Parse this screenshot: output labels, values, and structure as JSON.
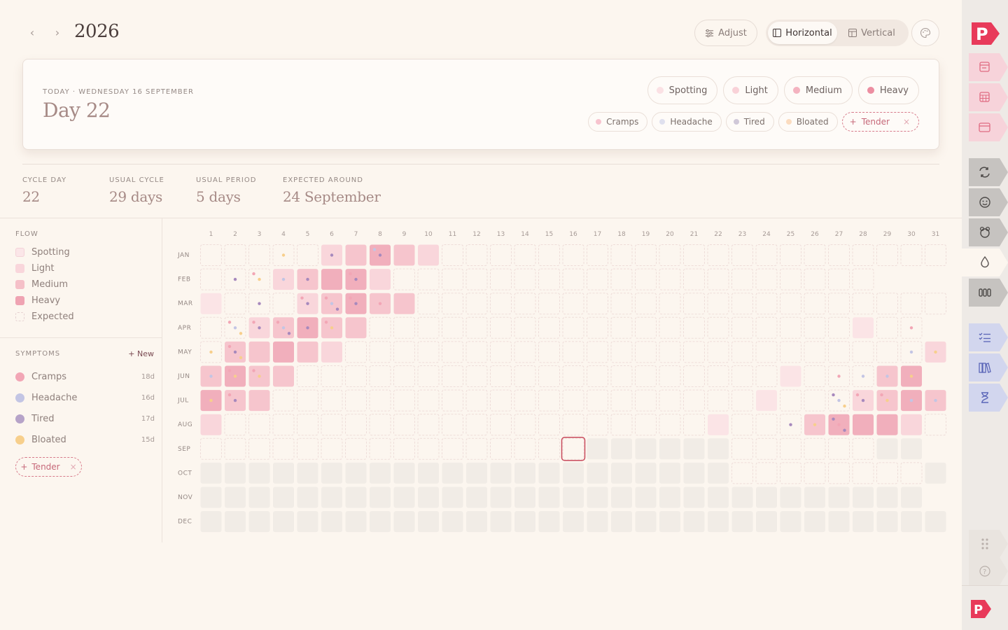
{
  "header": {
    "prev_icon": "chevron-left-icon",
    "next_icon": "chevron-right-icon",
    "year": "2026",
    "adjust_label": "Adjust",
    "view_horizontal_label": "Horizontal",
    "view_vertical_label": "Vertical",
    "palette_icon": "palette-icon"
  },
  "today": {
    "label": "TODAY · WEDNESDAY 16 SEPTEMBER",
    "day": "Day 22",
    "flow_options": [
      {
        "label": "Spotting",
        "color": "#fbe1e4"
      },
      {
        "label": "Light",
        "color": "#f9d2d8"
      },
      {
        "label": "Medium",
        "color": "#f4b3c0"
      },
      {
        "label": "Heavy",
        "color": "#ec8ea1"
      }
    ],
    "symptoms": [
      {
        "label": "Cramps",
        "color": "#f7c4cf"
      },
      {
        "label": "Headache",
        "color": "#dfe0ee"
      },
      {
        "label": "Tired",
        "color": "#d0c8d8"
      },
      {
        "label": "Bloated",
        "color": "#fbdcc0"
      }
    ],
    "add_symptom_label": "Tender",
    "add_symptom_remove": "×"
  },
  "stats": [
    {
      "label": "CYCLE DAY",
      "value": "22"
    },
    {
      "label": "USUAL CYCLE",
      "value": "29 days"
    },
    {
      "label": "USUAL PERIOD",
      "value": "5 days"
    },
    {
      "label": "EXPECTED AROUND",
      "value": "24 September"
    }
  ],
  "legend": {
    "flow_title": "FLOW",
    "flow_items": [
      {
        "label": "Spotting",
        "color": "#fbe6e8"
      },
      {
        "label": "Light",
        "color": "#f9d6db"
      },
      {
        "label": "Medium",
        "color": "#f5c0c8"
      },
      {
        "label": "Heavy",
        "color": "#efa3b2"
      },
      {
        "label": "Expected",
        "color": "#fcf6ef"
      }
    ],
    "symptoms_title": "SYMPTOMS",
    "new_label": "+ New",
    "symptoms": [
      {
        "label": "Cramps",
        "count": "18d",
        "color": "#f2a6b5"
      },
      {
        "label": "Headache",
        "count": "16d",
        "color": "#c3c5e4"
      },
      {
        "label": "Tired",
        "count": "17d",
        "color": "#b6a3c8"
      },
      {
        "label": "Bloated",
        "count": "15d",
        "color": "#f7cf8c"
      }
    ],
    "tender_label": "Tender",
    "tender_remove": "×"
  },
  "calendar": {
    "months": [
      "JAN",
      "FEB",
      "MAR",
      "APR",
      "MAY",
      "JUN",
      "JUL",
      "AUG",
      "SEP",
      "OCT",
      "NOV",
      "DEC"
    ],
    "days_in_month": [
      31,
      28,
      31,
      30,
      31,
      30,
      31,
      31,
      30,
      31,
      30,
      31
    ],
    "day_labels": [
      "1",
      "2",
      "3",
      "4",
      "5",
      "6",
      "7",
      "8",
      "9",
      "10",
      "11",
      "12",
      "13",
      "14",
      "15",
      "16",
      "17",
      "18",
      "19",
      "20",
      "21",
      "22",
      "23",
      "24",
      "25",
      "26",
      "27",
      "28",
      "29",
      "30",
      "31"
    ],
    "today": {
      "month": 9,
      "day": 16
    },
    "colors": {
      "spotting": "#fbe4e6",
      "light": "#f9d6db",
      "medium": "#f6c5cd",
      "heavy": "#f1afbc",
      "future": "#f1ece6",
      "cramps": "#f2a6b5",
      "headache": "#c3c5e4",
      "tired": "#a789bd",
      "bloated": "#f7cf8c",
      "today_border": "#c84a5c"
    },
    "flow": {
      "1": {
        "6": "light",
        "7": "medium",
        "8": "heavy",
        "9": "medium",
        "10": "light"
      },
      "2": {
        "4": "light",
        "5": "medium",
        "6": "heavy",
        "7": "heavy",
        "8": "light"
      },
      "3": {
        "1": "spotting",
        "5": "light",
        "6": "medium",
        "7": "heavy",
        "8": "medium",
        "9": "medium"
      },
      "4": {
        "3": "light",
        "4": "medium",
        "5": "heavy",
        "6": "medium",
        "7": "medium",
        "28": "spotting"
      },
      "5": {
        "2": "medium",
        "3": "medium",
        "4": "heavy",
        "5": "medium",
        "6": "light",
        "31": "light"
      },
      "6": {
        "1": "medium",
        "2": "heavy",
        "3": "medium",
        "4": "medium",
        "25": "spotting",
        "29": "medium",
        "30": "heavy"
      },
      "7": {
        "1": "heavy",
        "2": "medium",
        "3": "medium",
        "24": "spotting",
        "28": "light",
        "29": "medium",
        "30": "heavy",
        "31": "medium"
      },
      "8": {
        "1": "light",
        "22": "spotting",
        "26": "medium",
        "27": "heavy",
        "28": "heavy",
        "29": "heavy",
        "30": "light"
      }
    },
    "symptoms": {
      "1": {
        "4": [
          "bloated"
        ],
        "6": [
          "tired"
        ],
        "8": [
          "headache",
          "tired"
        ]
      },
      "2": {
        "2": [
          "tired"
        ],
        "3": [
          "cramps",
          "bloated"
        ],
        "4": [
          "headache"
        ],
        "5": [
          "tired"
        ],
        "7": [
          "cramps",
          "tired"
        ]
      },
      "3": {
        "3": [
          "tired"
        ],
        "5": [
          "cramps",
          "tired"
        ],
        "6": [
          "cramps",
          "headache",
          "tired"
        ],
        "7": [
          "cramps",
          "tired"
        ],
        "8": [
          "cramps"
        ]
      },
      "4": {
        "2": [
          "cramps",
          "headache",
          "bloated"
        ],
        "3": [
          "cramps",
          "tired"
        ],
        "4": [
          "cramps",
          "headache",
          "tired"
        ],
        "5": [
          "tired"
        ],
        "6": [
          "cramps",
          "bloated"
        ],
        "30": [
          "cramps"
        ]
      },
      "5": {
        "1": [
          "bloated"
        ],
        "2": [
          "cramps",
          "tired",
          "bloated"
        ],
        "30": [
          "headache"
        ],
        "31": [
          "bloated"
        ]
      },
      "6": {
        "1": [
          "headache"
        ],
        "2": [
          "cramps",
          "bloated"
        ],
        "3": [
          "cramps",
          "bloated"
        ],
        "27": [
          "cramps"
        ],
        "28": [
          "headache"
        ],
        "29": [
          "headache"
        ],
        "30": [
          "bloated"
        ]
      },
      "7": {
        "1": [
          "bloated"
        ],
        "2": [
          "cramps",
          "tired"
        ],
        "27": [
          "tired",
          "headache",
          "bloated"
        ],
        "28": [
          "cramps",
          "tired"
        ],
        "29": [
          "cramps",
          "bloated"
        ],
        "30": [
          "headache"
        ],
        "31": [
          "headache"
        ]
      },
      "8": {
        "1": [],
        "25": [
          "tired"
        ],
        "26": [
          "bloated"
        ],
        "27": [
          "tired",
          "cramps",
          "tired"
        ]
      }
    },
    "future_from": {
      "month": 9,
      "day": 17
    },
    "expected": {
      "9": [
        23,
        24,
        25,
        26,
        27,
        28
      ],
      "10": [
        23,
        24,
        25,
        26,
        27,
        28,
        29,
        30
      ]
    }
  },
  "rail": {
    "logo_label": "P",
    "tabs": [
      {
        "icon": "calendar-today-icon",
        "group": "pink"
      },
      {
        "icon": "calendar-grid-icon",
        "group": "pink"
      },
      {
        "icon": "calendar-week-icon",
        "group": "pink"
      },
      {
        "icon": "cycle-icon",
        "group": "gray"
      },
      {
        "icon": "mood-icon",
        "group": "gray"
      },
      {
        "icon": "symptom-icon",
        "group": "gray"
      },
      {
        "icon": "drop-icon",
        "group": "active"
      },
      {
        "icon": "bars-icon",
        "group": "gray"
      },
      {
        "icon": "checklist-icon",
        "group": "blue"
      },
      {
        "icon": "library-icon",
        "group": "blue"
      },
      {
        "icon": "hourglass-icon",
        "group": "blue"
      }
    ],
    "grip_icon": "grip-icon",
    "help_icon": "help-icon"
  }
}
